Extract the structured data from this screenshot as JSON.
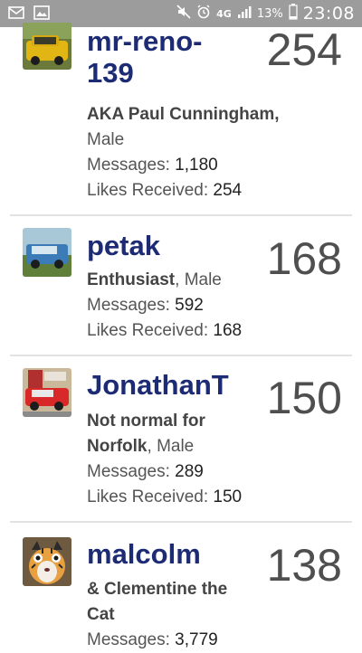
{
  "status_bar": {
    "network": "4G",
    "battery": "13%",
    "time": "23:08"
  },
  "members": [
    {
      "username_line1": "mr-reno-",
      "username_line2": "139",
      "score": "254",
      "title": "AKA Paul Cunningham",
      "gender": "Male",
      "messages_label": "Messages:",
      "messages": "1,180",
      "likes_label": "Likes Received:",
      "likes": "254"
    },
    {
      "username": "petak",
      "score": "168",
      "title": "Enthusiast",
      "gender": "Male",
      "messages_label": "Messages:",
      "messages": "592",
      "likes_label": "Likes Received:",
      "likes": "168"
    },
    {
      "username": "JonathanT",
      "score": "150",
      "title_line1": "Not normal for",
      "title_line2": "Norfolk",
      "gender": "Male",
      "messages_label": "Messages:",
      "messages": "289",
      "likes_label": "Likes Received:",
      "likes": "150"
    },
    {
      "username": "malcolm",
      "score": "138",
      "title_line1": "& Clementine the",
      "title_line2": "Cat",
      "messages_label": "Messages:",
      "messages": "3,779"
    }
  ]
}
